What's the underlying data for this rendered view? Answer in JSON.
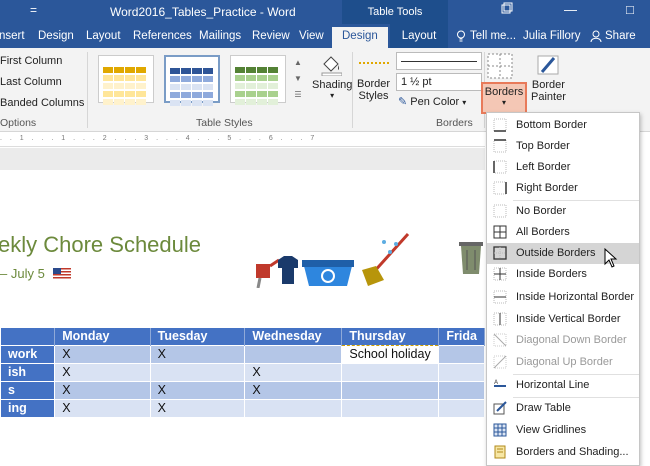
{
  "titlebar": {
    "quick_access": "=",
    "title": "Word2016_Tables_Practice - Word",
    "context_tools": "Table Tools",
    "restore_icon": "restore-icon",
    "minimize": "—",
    "maximize": "□"
  },
  "tabs": {
    "insert": "nsert",
    "design": "Design",
    "layout": "Layout",
    "references": "References",
    "mailings": "Mailings",
    "review": "Review",
    "view": "View",
    "table_design": "Design",
    "table_layout": "Layout",
    "tell_me": "Tell me...",
    "user": "Julia Fillory",
    "share": "Share"
  },
  "ribbon": {
    "options": {
      "first_column": "First Column",
      "last_column": "Last Column",
      "banded_columns": "Banded Columns",
      "label": "Options"
    },
    "table_styles": {
      "label": "Table Styles"
    },
    "shading": "Shading",
    "borders_group": {
      "border_styles_line1": "Border",
      "border_styles_line2": "Styles",
      "line_weight": "1 ½ pt",
      "pen_color": "Pen Color",
      "borders": "Borders",
      "border_painter_line1": "Border",
      "border_painter_line2": "Painter",
      "label": "Borders"
    },
    "accent_color": "#e87a5a"
  },
  "document": {
    "title": "ekly Chore Schedule",
    "subtitle": "– July 5",
    "table": {
      "headers": [
        "",
        "Monday",
        "Tuesday",
        "Wednesday",
        "Thursday",
        "Frida"
      ],
      "rows": [
        [
          "work",
          "X",
          "X",
          "",
          "School holiday",
          ""
        ],
        [
          "ish",
          "X",
          "",
          "X",
          "",
          ""
        ],
        [
          "s",
          "X",
          "X",
          "X",
          "",
          ""
        ],
        [
          "ing",
          "X",
          "X",
          "",
          "",
          ""
        ]
      ]
    }
  },
  "borders_menu": {
    "items": [
      {
        "label": "Bottom Border",
        "icon": "bottom-border-icon",
        "disabled": false
      },
      {
        "label": "Top Border",
        "icon": "top-border-icon",
        "disabled": false
      },
      {
        "label": "Left Border",
        "icon": "left-border-icon",
        "disabled": false
      },
      {
        "label": "Right Border",
        "icon": "right-border-icon",
        "disabled": false
      },
      {
        "label": "No Border",
        "icon": "no-border-icon",
        "disabled": false
      },
      {
        "label": "All Borders",
        "icon": "all-borders-icon",
        "disabled": false
      },
      {
        "label": "Outside Borders",
        "icon": "outside-borders-icon",
        "disabled": false,
        "highlighted": true
      },
      {
        "label": "Inside Borders",
        "icon": "inside-borders-icon",
        "disabled": false
      },
      {
        "label": "Inside Horizontal Border",
        "icon": "inside-horizontal-border-icon",
        "disabled": false
      },
      {
        "label": "Inside Vertical Border",
        "icon": "inside-vertical-border-icon",
        "disabled": false
      },
      {
        "label": "Diagonal Down Border",
        "icon": "diagonal-down-border-icon",
        "disabled": true
      },
      {
        "label": "Diagonal Up Border",
        "icon": "diagonal-up-border-icon",
        "disabled": true
      },
      {
        "label": "Horizontal Line",
        "icon": "horizontal-line-icon",
        "disabled": false
      },
      {
        "label": "Draw Table",
        "icon": "draw-table-icon",
        "disabled": false
      },
      {
        "label": "View Gridlines",
        "icon": "view-gridlines-icon",
        "disabled": false
      },
      {
        "label": "Borders and Shading...",
        "icon": "borders-and-shading-icon",
        "disabled": false
      }
    ]
  }
}
